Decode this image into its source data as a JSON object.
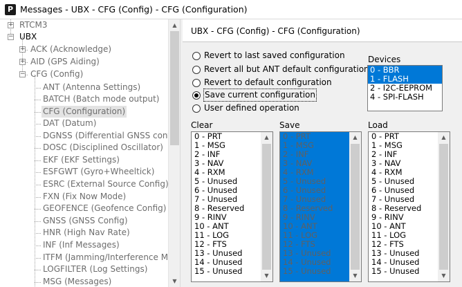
{
  "window": {
    "app_icon": "P",
    "title": "Messages - UBX - CFG (Config) - CFG (Configuration)"
  },
  "tree": [
    {
      "label": "RTCM3",
      "expander": "+",
      "selected": false,
      "dark": false
    },
    {
      "label": "UBX",
      "expander": "-",
      "selected": false,
      "dark": true
    },
    {
      "label": "ACK (Acknowledge)",
      "expander": "+",
      "selected": false,
      "dark": false
    },
    {
      "label": "AID (GPS Aiding)",
      "expander": "+",
      "selected": false,
      "dark": false
    },
    {
      "label": "CFG (Config)",
      "expander": "-",
      "selected": false,
      "dark": false
    },
    {
      "label": "ANT (Antenna Settings)",
      "expander": "",
      "selected": false,
      "dark": false
    },
    {
      "label": "BATCH (Batch mode output)",
      "expander": "",
      "selected": false,
      "dark": false
    },
    {
      "label": "CFG (Configuration)",
      "expander": "",
      "selected": true,
      "dark": false
    },
    {
      "label": "DAT (Datum)",
      "expander": "",
      "selected": false,
      "dark": false
    },
    {
      "label": "DGNSS (Differential GNSS configu",
      "expander": "",
      "selected": false,
      "dark": false
    },
    {
      "label": "DOSC (Disciplined Oscillator)",
      "expander": "",
      "selected": false,
      "dark": false
    },
    {
      "label": "EKF (EKF Settings)",
      "expander": "",
      "selected": false,
      "dark": false
    },
    {
      "label": "ESFGWT (Gyro+Wheeltick)",
      "expander": "",
      "selected": false,
      "dark": false
    },
    {
      "label": "ESRC (External Source Config)",
      "expander": "",
      "selected": false,
      "dark": false
    },
    {
      "label": "FXN (Fix Now Mode)",
      "expander": "",
      "selected": false,
      "dark": false
    },
    {
      "label": "GEOFENCE (Geofence Config)",
      "expander": "",
      "selected": false,
      "dark": false
    },
    {
      "label": "GNSS (GNSS Config)",
      "expander": "",
      "selected": false,
      "dark": false
    },
    {
      "label": "HNR (High Nav Rate)",
      "expander": "",
      "selected": false,
      "dark": false
    },
    {
      "label": "INF (Inf Messages)",
      "expander": "",
      "selected": false,
      "dark": false
    },
    {
      "label": "ITFM (Jamming/Interference Moni",
      "expander": "",
      "selected": false,
      "dark": false
    },
    {
      "label": "LOGFILTER (Log Settings)",
      "expander": "",
      "selected": false,
      "dark": false
    },
    {
      "label": "MSG (Messages)",
      "expander": "",
      "selected": false,
      "dark": false
    }
  ],
  "panel": {
    "title": "UBX - CFG (Config) - CFG (Configuration)",
    "options": [
      {
        "label": "Revert to last saved configuration",
        "checked": false
      },
      {
        "label": "Revert all but ANT default configuration",
        "checked": false
      },
      {
        "label": "Revert to default configuration",
        "checked": false
      },
      {
        "label": "Save current configuration",
        "checked": true
      },
      {
        "label": "User defined operation",
        "checked": false
      }
    ],
    "devices_label": "Devices",
    "devices": [
      {
        "label": "0 - BBR",
        "selected": true
      },
      {
        "label": "1 - FLASH",
        "selected": true
      },
      {
        "label": "2 - I2C-EEPROM",
        "selected": false
      },
      {
        "label": "4 - SPI-FLASH",
        "selected": false
      }
    ],
    "clear_label": "Clear",
    "save_label": "Save",
    "load_label": "Load",
    "items": [
      "0 - PRT",
      "1 - MSG",
      "2 - INF",
      "3 - NAV",
      "4 - RXM",
      "5 - Unused",
      "6 - Unused",
      "7 - Unused",
      "8 - Reserved",
      "9 - RINV",
      "10 - ANT",
      "11 - LOG",
      "12 - FTS",
      "13 - Unused",
      "14 - Unused",
      "15 - Unused"
    ]
  }
}
